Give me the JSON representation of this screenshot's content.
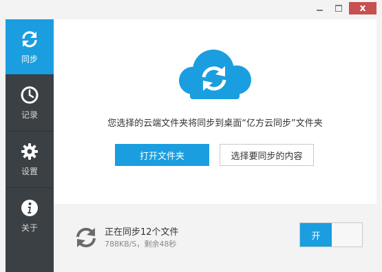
{
  "window": {
    "close_glyph": "x"
  },
  "sidebar": {
    "items": [
      {
        "label": "同步",
        "icon": "sync-icon",
        "active": true
      },
      {
        "label": "记录",
        "icon": "clock-icon",
        "active": false
      },
      {
        "label": "设置",
        "icon": "gear-icon",
        "active": false
      },
      {
        "label": "关于",
        "icon": "info-icon",
        "active": false
      }
    ]
  },
  "main": {
    "cloud_icon": "cloud-sync-icon",
    "description": "您选择的云端文件夹将同步到桌面“亿方云同步”文件夹",
    "open_folder_label": "打开文件夹",
    "choose_content_label": "选择要同步的内容"
  },
  "status": {
    "title": "正在同步12个文件",
    "subtitle": "788KB/S，剩余48秒",
    "toggle_on_label": "开"
  },
  "colors": {
    "accent": "#1a9ee0",
    "sidebar_bg": "#3b4044",
    "close_bg": "#c75050"
  }
}
